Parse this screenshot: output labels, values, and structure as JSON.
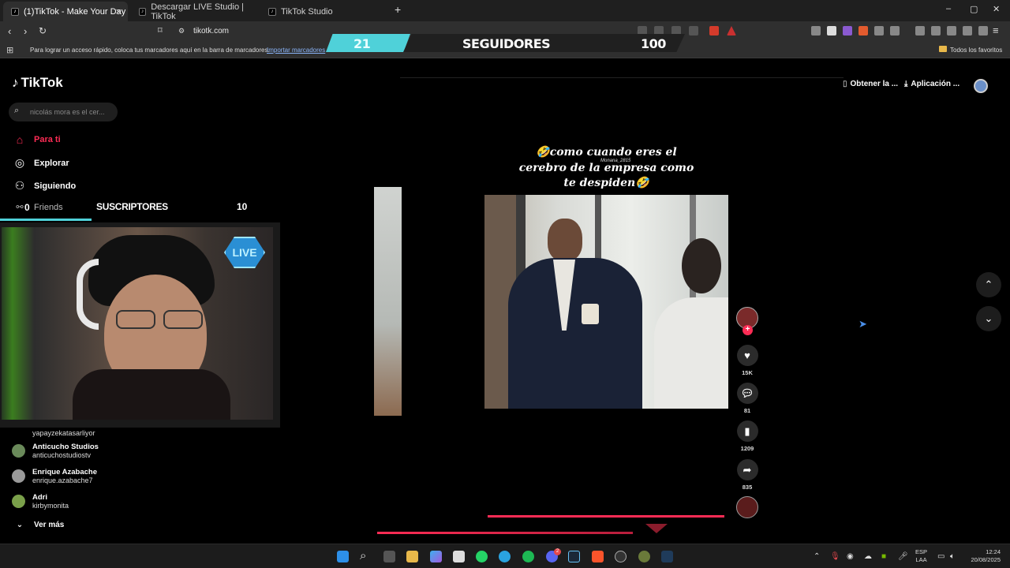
{
  "browser": {
    "tabs": [
      {
        "label": "(1)TikTok - Make Your Day",
        "active": true
      },
      {
        "label": "Descargar LIVE Studio | TikTok",
        "active": false
      },
      {
        "label": "TikTok Studio",
        "active": false
      }
    ],
    "url": "tikotk.com",
    "bookmarks_hint": "Para lograr un acceso rápido, coloca tus marcadores aquí en la barra de marcadores.",
    "bookmarks_import": "Importar marcadores",
    "all_favorites": "Todos los favoritos"
  },
  "overlay_followers": {
    "current": "21",
    "label": "SEGUIDORES",
    "goal": "100"
  },
  "overlay_subscribers": {
    "label": "SUSCRIPTORES",
    "current": "0",
    "goal": "10"
  },
  "webcam": {
    "live_badge": "LIVE"
  },
  "tiktok": {
    "logo": "TikTok",
    "search_placeholder": "nicolás mora es el cer...",
    "nav": [
      {
        "label": "Para ti",
        "icon": "home-icon",
        "active": true
      },
      {
        "label": "Explorar",
        "icon": "compass-icon",
        "active": false
      },
      {
        "label": "Siguiendo",
        "icon": "user-follow-icon",
        "active": false
      },
      {
        "label": "Friends",
        "icon": "friends-icon",
        "active": false
      }
    ],
    "accounts": [
      {
        "name": "",
        "username": "yapayzekatasarliyor"
      },
      {
        "name": "Anticucho Studios",
        "username": "anticuchostudiostv"
      },
      {
        "name": "Enrique Azabache",
        "username": "enrique.azabache7"
      },
      {
        "name": "Adri",
        "username": "kirbymonita"
      }
    ],
    "see_more": "Ver más",
    "header_links": {
      "coins": "Obtener la ...",
      "app": "Aplicación ..."
    },
    "video": {
      "caption_line1": "🤣como cuando eres el",
      "caption_line2": "cerebro de la empresa como",
      "caption_line3": "te despiden🤣",
      "watermark": "Monana_2815",
      "likes": "15K",
      "comments": "81",
      "saves": "1209",
      "shares": "835"
    }
  },
  "taskbar": {
    "language": "ESP",
    "region": "LAA",
    "time": "12:24",
    "date": "20/08/2025",
    "discord_badge": "2"
  },
  "colors": {
    "accent_red": "#fe2c55",
    "overlay_cyan": "#4fd1d9",
    "browser_bg": "#2f2f2f"
  }
}
